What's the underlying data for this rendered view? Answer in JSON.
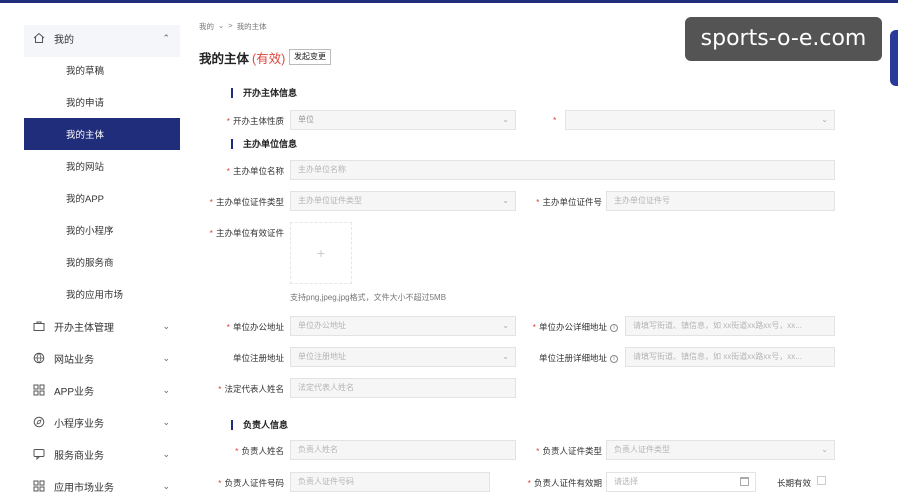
{
  "breadcrumb": [
    "我的",
    "我的主体"
  ],
  "page": {
    "title": "我的主体",
    "status": "(有效)",
    "change_button": "发起变更"
  },
  "watermark": "sports-o-e.com",
  "sidebar": {
    "groups": [
      {
        "label": "我的",
        "icon": "home-icon",
        "expanded": true
      },
      {
        "label": "开办主体管理",
        "icon": "briefcase-icon"
      },
      {
        "label": "网站业务",
        "icon": "globe-icon"
      },
      {
        "label": "APP业务",
        "icon": "apps-grid-icon"
      },
      {
        "label": "小程序业务",
        "icon": "compass-icon"
      },
      {
        "label": "服务商业务",
        "icon": "chat-icon"
      },
      {
        "label": "应用市场业务",
        "icon": "apps-grid-icon"
      }
    ],
    "my_items": [
      "我的草稿",
      "我的申请",
      "我的主体",
      "我的网站",
      "我的APP",
      "我的小程序",
      "我的服务商",
      "我的应用市场"
    ],
    "active_item": "我的主体"
  },
  "sections": {
    "s1": "开办主体信息",
    "s2": "主办单位信息",
    "s3": "负责人信息"
  },
  "form": {
    "nature_label": "开办主体性质",
    "nature_value": "单位",
    "org_name_label": "主办单位名称",
    "org_name_ph": "主办单位名称",
    "cert_type_label": "主办单位证件类型",
    "cert_type_ph": "主办单位证件类型",
    "cert_no_label": "主办单位证件号",
    "cert_no_ph": "主办单位证件号",
    "valid_cert_label": "主办单位有效证件",
    "upload_hint": "支持png,jpeg,jpg格式，文件大小不超过5MB",
    "office_addr_label": "单位办公地址",
    "office_addr_ph": "单位办公地址",
    "office_detail_label": "单位办公详细地址",
    "office_detail_ph": "请填写街道、镇信息，如 xx街道xx路xx号，xx...",
    "reg_addr_label": "单位注册地址",
    "reg_addr_ph": "单位注册地址",
    "reg_detail_label": "单位注册详细地址",
    "reg_detail_ph": "请填写街道、镇信息，如 xx街道xx路xx号，xx...",
    "legal_rep_label": "法定代表人姓名",
    "legal_rep_ph": "法定代表人姓名",
    "person_name_label": "负责人姓名",
    "person_name_ph": "负责人姓名",
    "person_cert_type_label": "负责人证件类型",
    "person_cert_type_ph": "负责人证件类型",
    "person_cert_no_label": "负责人证件号码",
    "person_cert_no_ph": "负责人证件号码",
    "person_cert_valid_label": "负责人证件有效期",
    "person_cert_valid_ph": "请选择",
    "long_term_label": "长期有效"
  }
}
